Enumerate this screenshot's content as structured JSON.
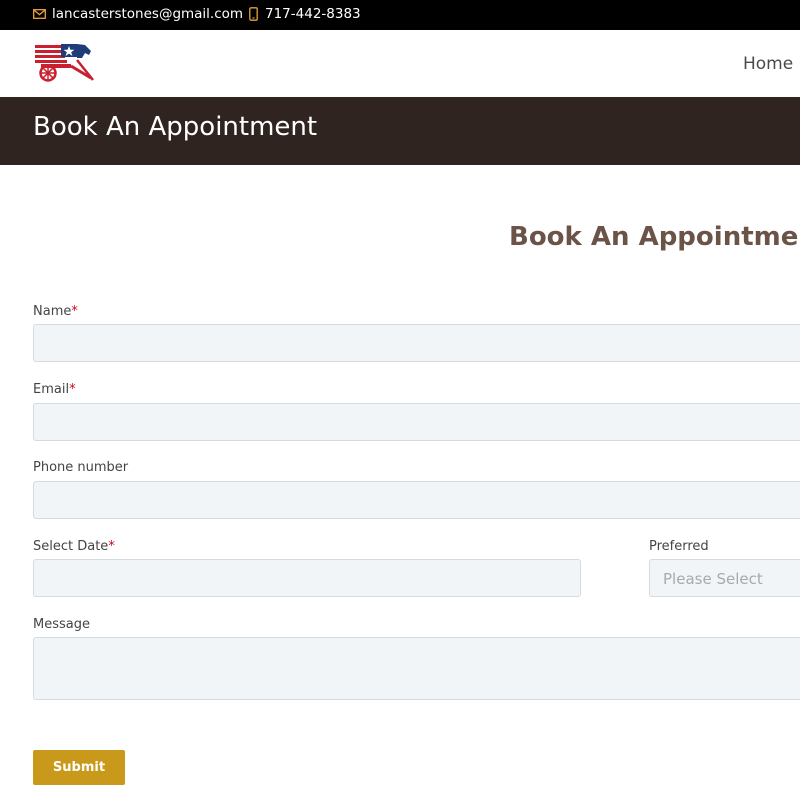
{
  "topbar": {
    "email": "lancasterstones@gmail.com",
    "phone": "717-442-8383",
    "accent_color": "#e8a33a"
  },
  "header": {
    "nav": {
      "home_label": "Home"
    },
    "logo_icon": "wagon-flag-logo-icon"
  },
  "banner": {
    "title": "Book An Appointment"
  },
  "form": {
    "title": "Book An Appointment",
    "required_marker": "*",
    "name_label": "Name",
    "email_label": "Email",
    "phone_label": "Phone number",
    "date_label": "Select Date",
    "preferred_label": "Preferred",
    "preferred_placeholder": "Please Select",
    "message_label": "Message",
    "submit_label": "Submit"
  },
  "colors": {
    "banner_bg": "#2f2420",
    "title_color": "#6b5348",
    "submit_bg": "#c9991c",
    "required": "#d0021b",
    "field_bg": "#f2f5f8"
  }
}
